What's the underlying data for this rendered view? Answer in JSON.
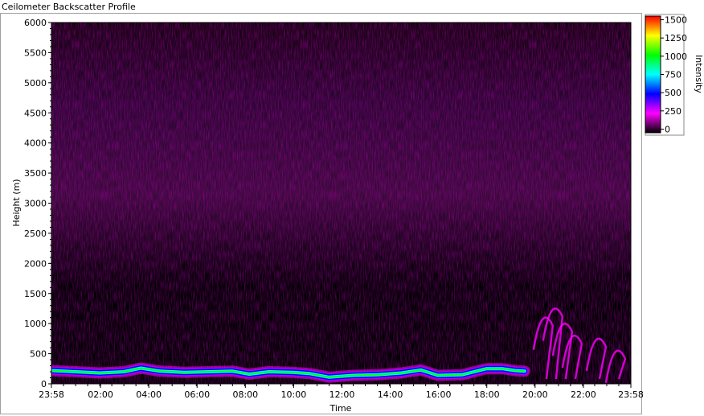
{
  "window_title": "Ceilometer Backscatter Profile",
  "chart_data": {
    "type": "heatmap",
    "title": "Ceilometer Backscatter Profile",
    "xlabel": "Time",
    "ylabel": "Height (m)",
    "x_tick_labels": [
      "23:58",
      "02:00",
      "04:00",
      "06:00",
      "08:00",
      "10:00",
      "12:00",
      "14:00",
      "16:00",
      "18:00",
      "20:00",
      "22:00",
      "23:58"
    ],
    "x_tick_hours": [
      0,
      2.033,
      4.033,
      6.033,
      8.033,
      10.033,
      12.033,
      14.033,
      16.033,
      18.033,
      20.033,
      22.033,
      24
    ],
    "xlim_hours": [
      0,
      24
    ],
    "y_ticks": [
      0,
      500,
      1000,
      1500,
      2000,
      2500,
      3000,
      3500,
      4000,
      4500,
      5000,
      5500,
      6000
    ],
    "ylim": [
      0,
      6000
    ],
    "colorbar": {
      "label": "Intensity",
      "ticks": [
        0,
        250,
        500,
        750,
        1000,
        1250,
        1500
      ],
      "range": [
        -50,
        1550
      ],
      "colors": [
        "#000000",
        "#ff00ff",
        "#0000ff",
        "#00ffff",
        "#00ff00",
        "#ffff00",
        "#ff0000"
      ]
    },
    "boundary_layer_height_m": [
      [
        0,
        220
      ],
      [
        1,
        200
      ],
      [
        2,
        180
      ],
      [
        3,
        200
      ],
      [
        3.7,
        260
      ],
      [
        4.5,
        210
      ],
      [
        5.5,
        190
      ],
      [
        6.5,
        200
      ],
      [
        7.5,
        210
      ],
      [
        8.2,
        160
      ],
      [
        9,
        200
      ],
      [
        10,
        190
      ],
      [
        10.7,
        170
      ],
      [
        11.5,
        110
      ],
      [
        12.5,
        140
      ],
      [
        13.5,
        150
      ],
      [
        14.5,
        180
      ],
      [
        15.3,
        230
      ],
      [
        16,
        140
      ],
      [
        17,
        150
      ],
      [
        18,
        250
      ],
      [
        18.7,
        250
      ],
      [
        19.2,
        220
      ],
      [
        19.6,
        210
      ]
    ],
    "evening_features_m": [
      [
        20.3,
        1100
      ],
      [
        20.7,
        1250
      ],
      [
        21.1,
        1000
      ],
      [
        21.5,
        800
      ],
      [
        22.5,
        750
      ],
      [
        23.3,
        550
      ]
    ],
    "background_level": 100,
    "aloft_layer_m": [
      2000,
      4800
    ]
  }
}
